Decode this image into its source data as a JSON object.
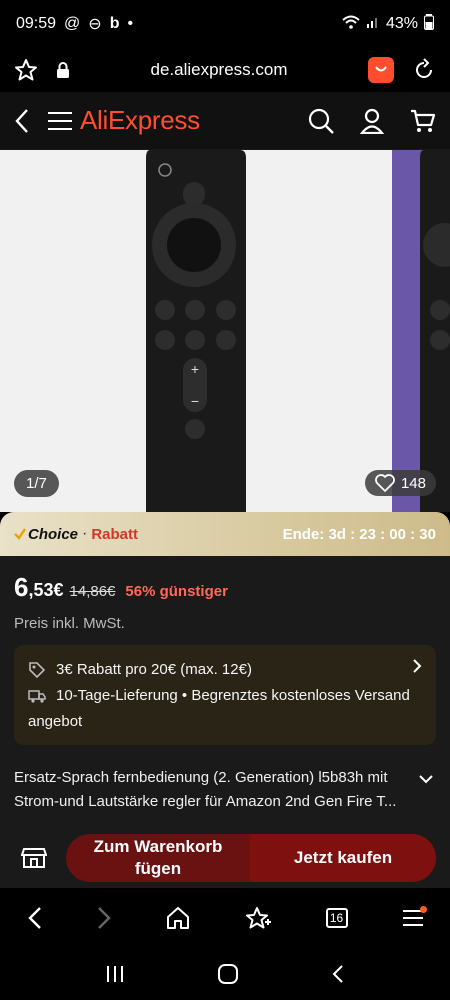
{
  "status": {
    "time": "09:59",
    "battery": "43%"
  },
  "browser": {
    "url": "de.aliexpress.com"
  },
  "header": {
    "logo": "AliExpress"
  },
  "gallery": {
    "counter": "1/7",
    "likes": "148"
  },
  "promo": {
    "choice": "Choice",
    "dot": "·",
    "rabatt": "Rabatt",
    "ende": "Ende: 3d : 23 : 00 : 30"
  },
  "price": {
    "whole": "6",
    "cents": ",53",
    "currency": "€",
    "old": "14,86€",
    "discount": "56% günstiger",
    "tax": "Preis inkl. MwSt."
  },
  "offers": {
    "coupon": "3€ Rabatt pro 20€ (max. 12€)",
    "delivery": "10-Tage-Lieferung • Begrenztes kostenloses Versand",
    "delivery2": "angebot"
  },
  "product": {
    "title": "Ersatz-Sprach fernbedienung (2. Generation) l5b83h mit Strom-und Lautstärke regler für Amazon 2nd Gen Fire T..."
  },
  "actions": {
    "cart_line1": "Zum Warenkorb",
    "cart_line2": "fügen",
    "buy": "Jetzt kaufen"
  },
  "browser_nav": {
    "tabs_count": "16"
  },
  "colors": {
    "brand": "#ff4d2e",
    "cta": "#7e1010",
    "discount": "#ff6a5a"
  }
}
